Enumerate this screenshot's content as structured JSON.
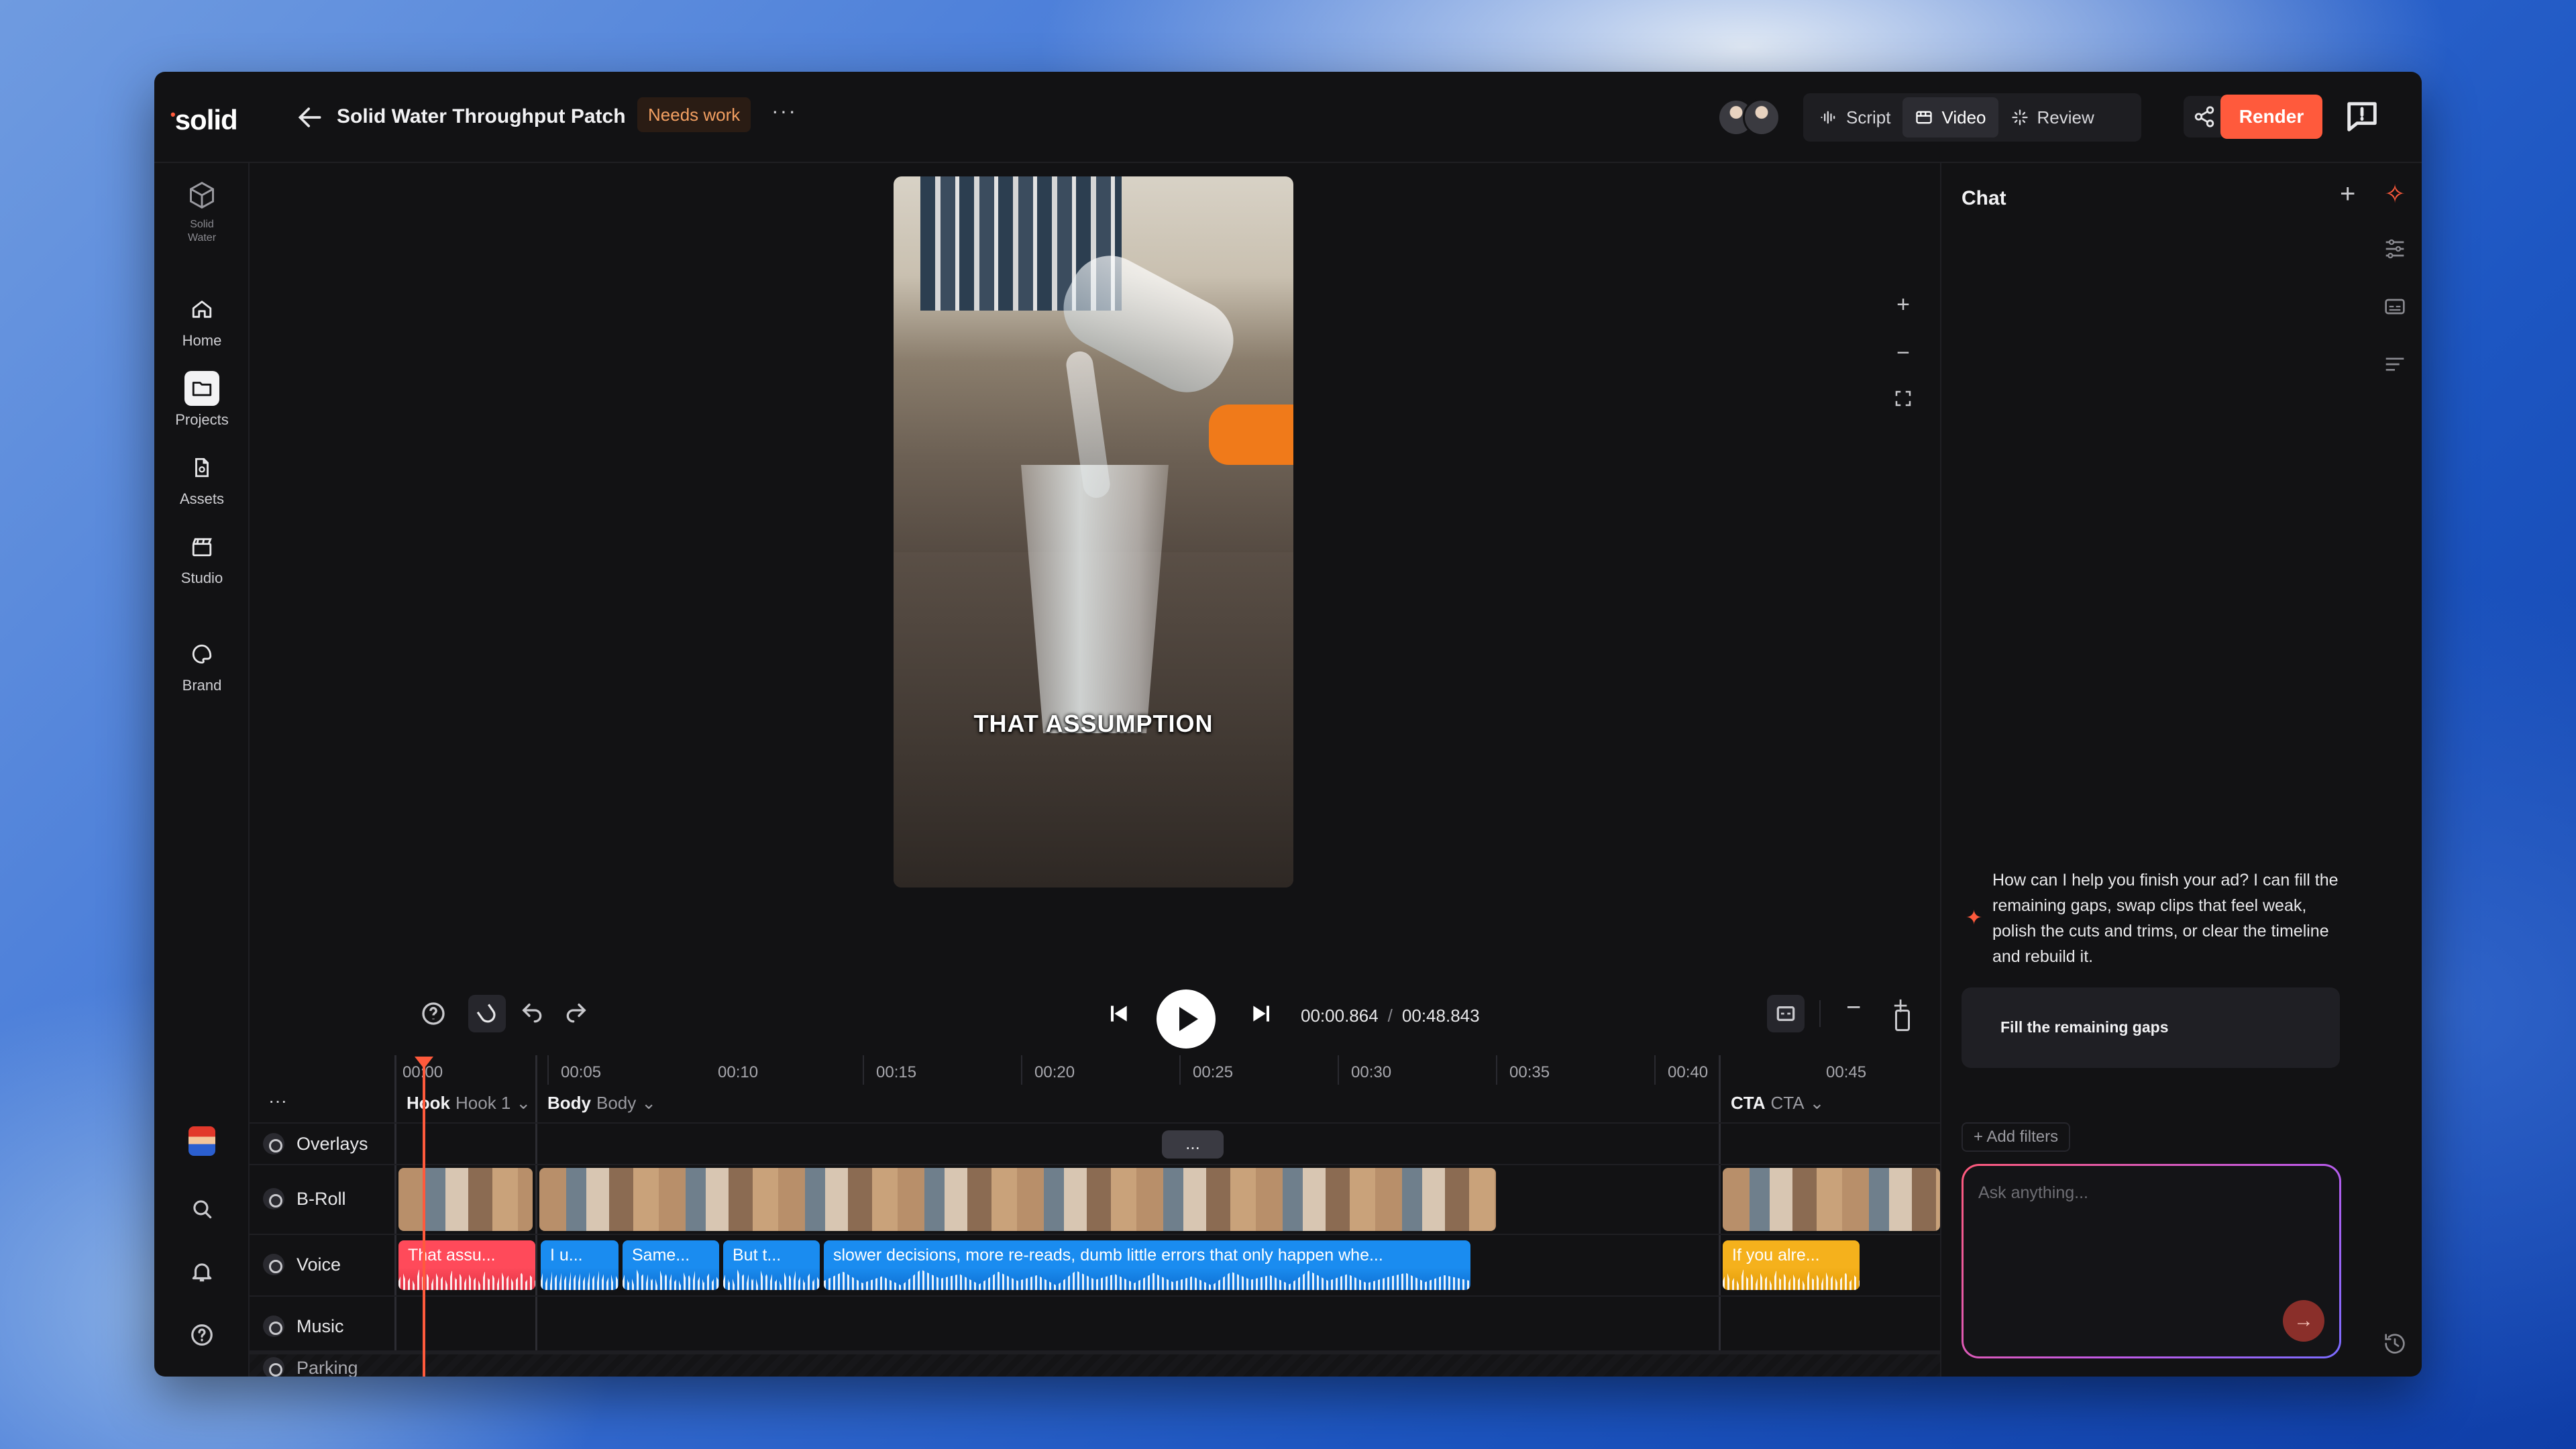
{
  "app": {
    "logo": "solid"
  },
  "header": {
    "title": "Solid Water Throughput Patch",
    "status_badge": "Needs work",
    "more": "···",
    "modes": [
      {
        "label": "Script",
        "icon": "waveform-icon"
      },
      {
        "label": "Video",
        "icon": "film-icon",
        "active": true
      },
      {
        "label": "Review",
        "icon": "sparkle-icon"
      }
    ],
    "render_label": "Render",
    "accent": "#ff5a3c"
  },
  "sidebar": {
    "workspace": {
      "line1": "Solid",
      "line2": "Water"
    },
    "items": [
      {
        "label": "Home",
        "icon": "home-icon"
      },
      {
        "label": "Projects",
        "icon": "folder-icon",
        "active": true
      },
      {
        "label": "Assets",
        "icon": "file-icon"
      },
      {
        "label": "Studio",
        "icon": "clapperboard-icon"
      },
      {
        "label": "Brand",
        "icon": "palette-icon"
      }
    ]
  },
  "preview": {
    "caption": "THAT ASSUMPTION"
  },
  "player": {
    "current_time": "00:00.864",
    "separator": "/",
    "total_time": "00:48.843"
  },
  "timeline": {
    "ruler": [
      "00:00",
      "00:05",
      "00:10",
      "00:15",
      "00:20",
      "00:25",
      "00:30",
      "00:35",
      "00:40",
      "00:45"
    ],
    "more": "···",
    "sections": [
      {
        "name": "Hook",
        "sub": "Hook 1"
      },
      {
        "name": "Body",
        "sub": "Body"
      },
      {
        "name": "CTA",
        "sub": "CTA"
      }
    ],
    "tracks": [
      {
        "label": "Overlays"
      },
      {
        "label": "B-Roll"
      },
      {
        "label": "Voice"
      },
      {
        "label": "Music"
      },
      {
        "label": "Parking"
      }
    ],
    "overlay_pill": "...",
    "voice_clips": [
      "That assu...",
      "I u...",
      "Same...",
      "But t...",
      "slower decisions, more re-reads, dumb little errors that only happen whe...",
      "If you alre..."
    ]
  },
  "chat": {
    "title": "Chat",
    "assistant_message": "How can I help you finish your ad? I can fill the remaining gaps, swap clips that feel weak, polish the cuts and trims, or clear the timeline and rebuild it.",
    "suggestion": "Fill the remaining gaps",
    "add_filters": "+ Add filters",
    "input_placeholder": "Ask anything..."
  }
}
